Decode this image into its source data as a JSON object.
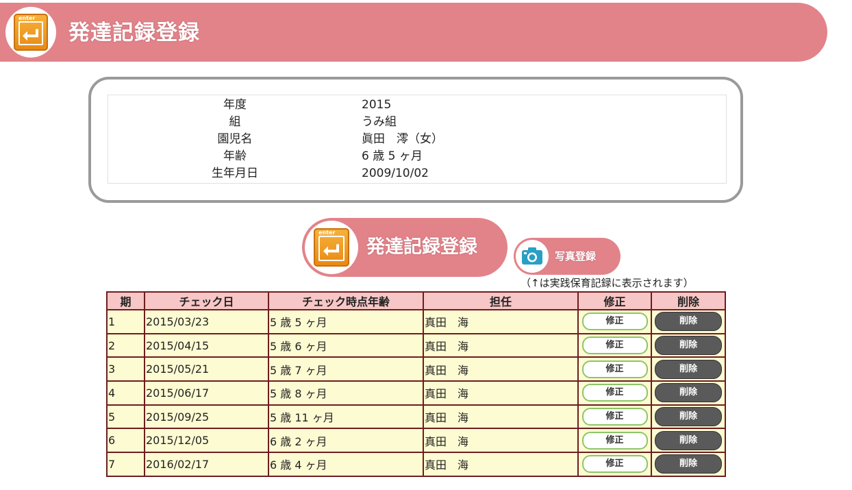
{
  "header": {
    "title": "発達記録登録",
    "icon_word": "enter"
  },
  "info": {
    "rows": [
      {
        "label": "年度",
        "value": "2015"
      },
      {
        "label": "組",
        "value": "うみ組"
      },
      {
        "label": "園児名",
        "value": "眞田　澪（女）"
      },
      {
        "label": "年齢",
        "value": "6 歳 5 ヶ月"
      },
      {
        "label": "生年月日",
        "value": "2009/10/02"
      }
    ]
  },
  "register_button": {
    "label": "発達記録登録",
    "icon_word": "enter"
  },
  "photo_button": {
    "label": "写真登録"
  },
  "note": "（↑は実践保育記録に表示されます）",
  "table": {
    "headers": [
      "期",
      "チェック日",
      "チェック時点年齢",
      "担任",
      "修正",
      "削除"
    ],
    "edit_label": "修正",
    "delete_label": "削除",
    "rows": [
      {
        "period": "1",
        "date": "2015/03/23",
        "age": "5 歳 5 ヶ月",
        "teacher": "真田　海"
      },
      {
        "period": "2",
        "date": "2015/04/15",
        "age": "5 歳 6 ヶ月",
        "teacher": "真田　海"
      },
      {
        "period": "3",
        "date": "2015/05/21",
        "age": "5 歳 7 ヶ月",
        "teacher": "真田　海"
      },
      {
        "period": "4",
        "date": "2015/06/17",
        "age": "5 歳 8 ヶ月",
        "teacher": "真田　海"
      },
      {
        "period": "5",
        "date": "2015/09/25",
        "age": "5 歳 11 ヶ月",
        "teacher": "真田　海"
      },
      {
        "period": "6",
        "date": "2015/12/05",
        "age": "6 歳 2 ヶ月",
        "teacher": "真田　海"
      },
      {
        "period": "7",
        "date": "2016/02/17",
        "age": "6 歳 4 ヶ月",
        "teacher": "真田　海"
      }
    ]
  },
  "colors": {
    "banner": "#e2838a",
    "panel_border": "#9a9a9a",
    "table_border": "#6d1d1d",
    "table_header_bg": "#f7c6c6",
    "table_row_bg": "#fdfbd2",
    "edit_border": "#8cc665",
    "delete_bg": "#5a5a5a"
  },
  "icons": {
    "enter": "enter-key-icon",
    "photo": "camera-icon"
  }
}
